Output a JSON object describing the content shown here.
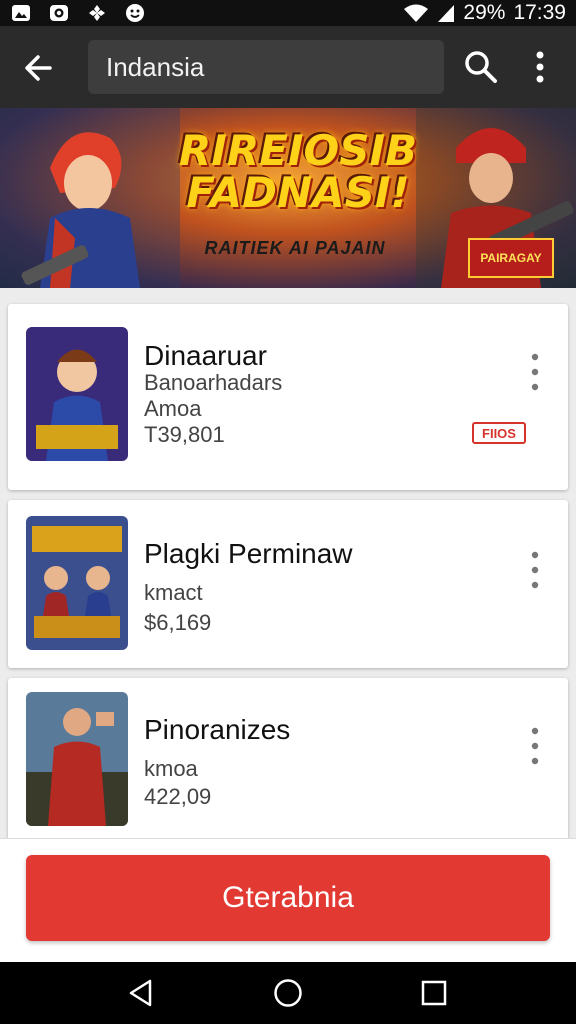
{
  "status_bar": {
    "battery": "29%",
    "time": "17:39"
  },
  "app_bar": {
    "search_value": "Indansia"
  },
  "banner": {
    "title": "RIREIOSIB FADNASI!",
    "subtitle": "RAITIEK AI PAJAIN",
    "badge": "PAIRAGAY"
  },
  "results": [
    {
      "title": "Dinaaruar",
      "lines": [
        "Banoarhadars",
        "Amoa",
        "T39,801"
      ],
      "tag": "FIIOS"
    },
    {
      "title": "Plagki Perminaw",
      "lines": [
        "kmact",
        "$6,169"
      ]
    },
    {
      "title": "Pinoranizes",
      "lines": [
        "kmoa",
        "422,09"
      ]
    }
  ],
  "action": {
    "label": "Gterabnia"
  },
  "colors": {
    "accent": "#e23a33",
    "app_bar": "#2b2b2b"
  },
  "icons": [
    "back-arrow-icon",
    "search-icon",
    "overflow-menu-icon",
    "wifi-icon",
    "signal-icon",
    "nav-back-icon",
    "nav-home-icon",
    "nav-recents-icon"
  ]
}
